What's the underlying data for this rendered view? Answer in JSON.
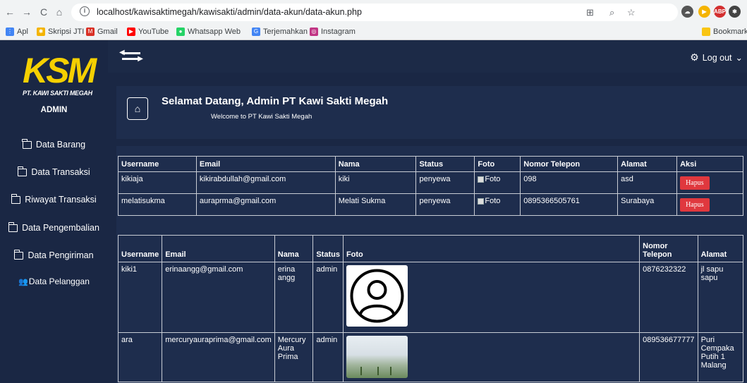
{
  "browser": {
    "url": "localhost/kawisaktimegah/kawisakti/admin/data-akun/data-akun.php",
    "bookmarks": [
      "Apl",
      "Skripsi JTI",
      "Gmail",
      "YouTube",
      "Whatsapp Web",
      "Terjemahkan",
      "Instagram"
    ],
    "bookmarks_right": "Bookmark l"
  },
  "sidebar": {
    "logo_text": "KSM",
    "logo_sub": "PT. KAWI SAKTI MEGAH",
    "role": "ADMIN",
    "items": [
      {
        "label": "Data Barang",
        "icon": "folder-icon"
      },
      {
        "label": "Data Transaksi",
        "icon": "folder-icon"
      },
      {
        "label": "Riwayat Transaksi",
        "icon": "folder-icon"
      },
      {
        "label": "Data Pengembalian",
        "icon": "folder-icon"
      },
      {
        "label": "Data Pengiriman",
        "icon": "folder-icon"
      },
      {
        "label": "Data Pelanggan",
        "icon": "users-icon"
      }
    ]
  },
  "topbar": {
    "logout_label": "Log out"
  },
  "welcome": {
    "title": "Selamat Datang, Admin PT Kawi Sakti Megah",
    "subtitle": "Welcome to PT Kawi Sakti Megah"
  },
  "table1": {
    "headers": [
      "Username",
      "Email",
      "Nama",
      "Status",
      "Foto",
      "Nomor Telepon",
      "Alamat",
      "Aksi"
    ],
    "rows": [
      {
        "username": "kikiaja",
        "email": "kikirabdullah@gmail.com",
        "nama": "kiki",
        "status": "penyewa",
        "foto": "Foto",
        "telepon": "098",
        "alamat": "asd",
        "aksi": "Hapus"
      },
      {
        "username": "melatisukma",
        "email": "auraprma@gmail.com",
        "nama": "Melati Sukma",
        "status": "penyewa",
        "foto": "Foto",
        "telepon": "0895366505761",
        "alamat": "Surabaya",
        "aksi": "Hapus"
      }
    ]
  },
  "table2": {
    "headers": [
      "Username",
      "Email",
      "Nama",
      "Status",
      "Foto",
      "Nomor Telepon",
      "Alamat"
    ],
    "rows": [
      {
        "username": "kiki1",
        "email": "erinaangg@gmail.com",
        "nama": "erina angg",
        "status": "admin",
        "telepon": "0876232322",
        "alamat": "jl sapu sapu"
      },
      {
        "username": "ara",
        "email": "mercuryauraprima@gmail.com",
        "nama": "Mercury Aura Prima",
        "status": "admin",
        "telepon": "089536677777",
        "alamat": "Puri Cempaka Putih 1 Malang"
      }
    ]
  }
}
